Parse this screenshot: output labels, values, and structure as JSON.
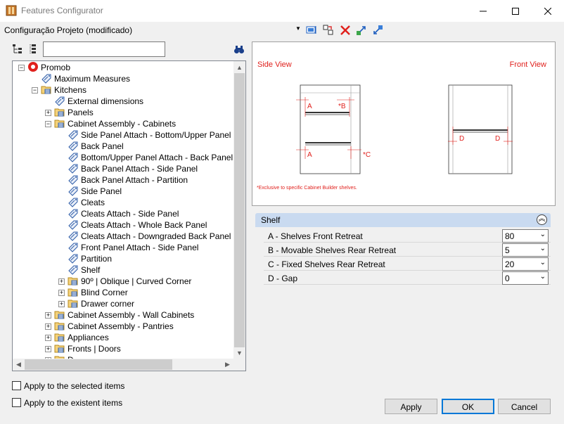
{
  "window": {
    "title": "Features Configurator"
  },
  "config": {
    "label": "Configuração Projeto (modificado)"
  },
  "search": {
    "value": ""
  },
  "tree": {
    "items": [
      {
        "label": "Promob",
        "depth": 0,
        "expander": "minus",
        "icon": "promob-logo-icon"
      },
      {
        "label": "Maximum Measures",
        "depth": 1,
        "expander": "",
        "icon": "tag-icon"
      },
      {
        "label": "Kitchens",
        "depth": 1,
        "expander": "minus",
        "icon": "folder-icon"
      },
      {
        "label": "External dimensions",
        "depth": 2,
        "expander": "",
        "icon": "tag-icon"
      },
      {
        "label": "Panels",
        "depth": 2,
        "expander": "plus",
        "icon": "folder-icon"
      },
      {
        "label": "Cabinet Assembly - Cabinets",
        "depth": 2,
        "expander": "minus",
        "icon": "folder-icon"
      },
      {
        "label": "Side Panel Attach - Bottom/Upper Panel",
        "depth": 3,
        "expander": "",
        "icon": "tag-icon"
      },
      {
        "label": "Back Panel",
        "depth": 3,
        "expander": "",
        "icon": "tag-icon"
      },
      {
        "label": " Bottom/Upper Panel Attach - Back Panel",
        "depth": 3,
        "expander": "",
        "icon": "tag-icon"
      },
      {
        "label": "Back Panel Attach - Side Panel",
        "depth": 3,
        "expander": "",
        "icon": "tag-icon"
      },
      {
        "label": "Back Panel Attach - Partition",
        "depth": 3,
        "expander": "",
        "icon": "tag-icon"
      },
      {
        "label": "Side Panel",
        "depth": 3,
        "expander": "",
        "icon": "tag-icon"
      },
      {
        "label": "Cleats",
        "depth": 3,
        "expander": "",
        "icon": "tag-icon"
      },
      {
        "label": "Cleats Attach - Side Panel",
        "depth": 3,
        "expander": "",
        "icon": "tag-icon"
      },
      {
        "label": "Cleats Attach - Whole Back Panel",
        "depth": 3,
        "expander": "",
        "icon": "tag-icon"
      },
      {
        "label": "Cleats Attach - Downgraded Back Panel | Ba",
        "depth": 3,
        "expander": "",
        "icon": "tag-icon"
      },
      {
        "label": "Front Panel Attach - Side Panel",
        "depth": 3,
        "expander": "",
        "icon": "tag-icon"
      },
      {
        "label": "Partition",
        "depth": 3,
        "expander": "",
        "icon": "tag-icon"
      },
      {
        "label": "Shelf",
        "depth": 3,
        "expander": "",
        "icon": "tag-icon"
      },
      {
        "label": "90º | Oblique | Curved Corner",
        "depth": 3,
        "expander": "plus",
        "icon": "folder-icon"
      },
      {
        "label": "Blind Corner",
        "depth": 3,
        "expander": "plus",
        "icon": "folder-icon"
      },
      {
        "label": "Drawer corner",
        "depth": 3,
        "expander": "plus",
        "icon": "folder-icon"
      },
      {
        "label": "Cabinet Assembly - Wall Cabinets",
        "depth": 2,
        "expander": "plus",
        "icon": "folder-icon"
      },
      {
        "label": "Cabinet Assembly - Pantries",
        "depth": 2,
        "expander": "plus",
        "icon": "folder-icon"
      },
      {
        "label": "Appliances",
        "depth": 2,
        "expander": "plus",
        "icon": "folder-icon"
      },
      {
        "label": "Fronts | Doors",
        "depth": 2,
        "expander": "plus",
        "icon": "folder-icon"
      },
      {
        "label": "D",
        "depth": 2,
        "expander": "plus",
        "icon": "folder-icon"
      }
    ]
  },
  "preview": {
    "side_label": "Side View",
    "front_label": "Front View",
    "note": "*Exclusive to specific Cabinet Builder shelves.",
    "marks": {
      "a": "A",
      "b": "*B",
      "c": "*C",
      "d": "D"
    }
  },
  "properties": {
    "group": "Shelf",
    "rows": [
      {
        "name": "A - Shelves Front Retreat",
        "value": "80"
      },
      {
        "name": "B - Movable Shelves Rear Retreat",
        "value": "5"
      },
      {
        "name": "C - Fixed Shelves Rear Retreat",
        "value": "20"
      },
      {
        "name": "D - Gap",
        "value": "0"
      }
    ]
  },
  "options": {
    "apply_selected": "Apply to the selected items",
    "apply_existent": "Apply to the existent items"
  },
  "buttons": {
    "apply": "Apply",
    "ok": "OK",
    "cancel": "Cancel"
  },
  "colors": {
    "accent_red": "#e0201c",
    "header_blue": "#c9daf0"
  }
}
